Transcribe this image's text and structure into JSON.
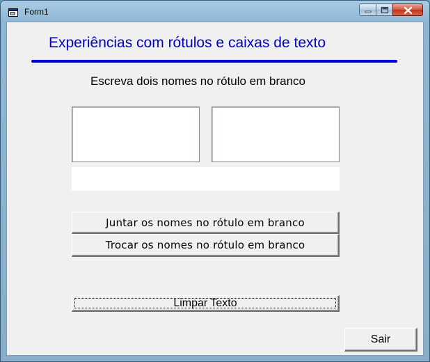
{
  "window": {
    "title": "Form1"
  },
  "form": {
    "heading": "Experiências com rótulos e caixas de texto",
    "instruction": "Escreva dois nomes no rótulo em branco",
    "textbox1_value": "",
    "textbox2_value": "",
    "result_label": "",
    "buttons": {
      "join": "Juntar os nomes no rótulo em branco",
      "swap": "Trocar os nomes no rótulo em branco",
      "clear": "Limpar Texto",
      "exit": "Sair"
    }
  },
  "colors": {
    "heading": "#0000c8",
    "rule": "#0000e0",
    "client_background": "#f0f0f0"
  }
}
